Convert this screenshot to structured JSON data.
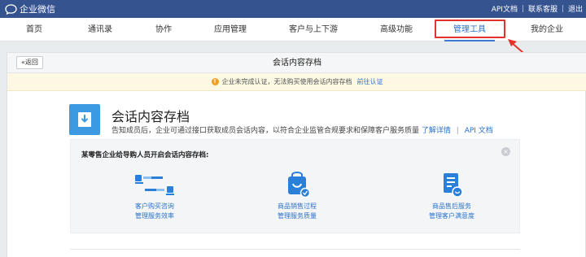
{
  "topbar": {
    "app_name": "企业微信",
    "links": [
      "API文档",
      "联系客服",
      "退出"
    ]
  },
  "nav": {
    "items": [
      "首页",
      "通讯录",
      "协作",
      "应用管理",
      "客户与上下游",
      "高级功能",
      "管理工具",
      "我的企业"
    ],
    "active_index": 6
  },
  "panel": {
    "back_label": "«返回",
    "title": "会话内容存档"
  },
  "warning": {
    "text": "企业未完成认证，无法购买使用会话内容存档",
    "link": "前往认证"
  },
  "feature": {
    "title": "会话内容存档",
    "description": "告知成员后，企业可通过接口获取成员会话内容，以符合企业监管合规要求和保障客户服务质量",
    "learn_more": "了解详情",
    "separator": "|",
    "api_doc": "API 文档"
  },
  "card": {
    "title": "某零售企业给导购人员开启会话内容存档:",
    "close_symbol": "×",
    "steps": [
      {
        "line1": "客户购买咨询",
        "line2": "管理服务效率",
        "icon": "chat-users-icon"
      },
      {
        "line1": "商品销售过程",
        "line2": "管理服务质量",
        "icon": "shopping-bag-icon"
      },
      {
        "line1": "商品售后服务",
        "line2": "管理客户满意度",
        "icon": "service-doc-icon"
      }
    ]
  },
  "colors": {
    "topbar": "#35538f",
    "accent": "#2a72c8",
    "highlight_box": "#e4332a",
    "warning_bg": "#fdf8e4",
    "feature_icon": "#3b9ae1"
  }
}
